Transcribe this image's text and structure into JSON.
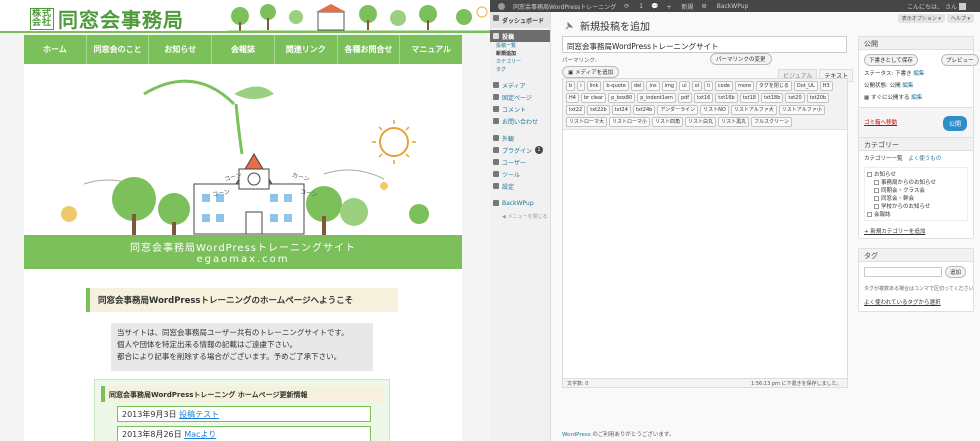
{
  "site": {
    "logo_badge": "株式会社",
    "logo_text": "同窓会事務局",
    "nav": [
      "ホーム",
      "同窓会のこと",
      "お知らせ",
      "会報誌",
      "関連リンク",
      "各種お問合せ",
      "マニュアル"
    ],
    "hero_title": "同窓会事務局WordPressトレーニングサイト",
    "hero_domain": "egaomax.com",
    "hero_words": [
      "コーン",
      "カーン",
      "コーン",
      "コーン"
    ],
    "welcome": "同窓会事務局WordPressトレーニングのホームページへようこそ",
    "notice": [
      "当サイトは、同窓会事務局ユーザー共有のトレーニングサイトです。",
      "個人や団体を特定出来る情報の記載はご遠慮下さい。",
      "都合により記事を削除する場合がございます。予めご了承下さい。"
    ],
    "news_title": "同窓会事務局WordPressトレーニング ホームページ更新情報",
    "news": [
      {
        "date": "2013年9月3日",
        "link": "投稿テスト"
      },
      {
        "date": "2013年8月26日",
        "link": "Macより"
      }
    ]
  },
  "admin": {
    "bar": {
      "site": "同窓会事務局WordPressトレーニング",
      "updates": "1",
      "new": "新規",
      "plugin": "BackWPup",
      "greeting": "こんにちは、",
      "user": "さん"
    },
    "menu": {
      "dashboard": "ダッシュボード",
      "posts": "投稿",
      "posts_sub": [
        "投稿一覧",
        "新規追加",
        "カテゴリー",
        "タグ"
      ],
      "media": "メディア",
      "pages": "固定ページ",
      "comments": "コメント",
      "inquiries": "お問い合わせ",
      "appearance": "外観",
      "plugins": "プラグイン",
      "plugins_badge": "1",
      "users": "ユーザー",
      "tools": "ツール",
      "settings": "設定",
      "backwpup": "BackWPup",
      "collapse": "メニューを閉じる"
    },
    "screen_options": "表示オプション ▾",
    "help": "ヘルプ ▾",
    "page_title": "新規投稿を追加",
    "post_title": "同窓会事務局WordPressトレーニングサイト",
    "permalink_label": "パーマリンク:",
    "permalink_button": "パーマリンクの変更",
    "media_button": "メディアを追加",
    "tabs": [
      "ビジュアル",
      "テキスト"
    ],
    "quicktags": [
      "b",
      "i",
      "link",
      "b-quote",
      "del",
      "ins",
      "img",
      "ul",
      "ol",
      "li",
      "code",
      "more",
      "タグを閉じる",
      "Dot_UL",
      "H3",
      "H4",
      "br clear",
      "p_box80",
      "p_indent1em",
      "pdf",
      "txt16",
      "txt16b",
      "txt18",
      "txt18b",
      "txt20",
      "txt20b",
      "txt22",
      "txt22b",
      "txt24",
      "txt24b",
      "アンダーライン",
      "リストNO",
      "リストアルファ大",
      "リストアルファ小",
      "リストローマ大",
      "リストローマ小",
      "リスト四角",
      "リスト白丸",
      "リスト黒丸",
      "フルスクリーン"
    ],
    "word_count": "文字数: 0",
    "saved": "1:56:13 pm に下書きを保存しました。",
    "footer_link": "WordPress",
    "footer_text": " のご利用ありがとうございます。",
    "publish": {
      "title": "公開",
      "save_draft": "下書きとして保存",
      "preview": "プレビュー",
      "status": "ステータス: 下書き",
      "edit": "編集",
      "visibility": "公開状態: 公開",
      "schedule": "すぐに公開する",
      "trash": "ゴミ箱へ移動",
      "publish": "公開"
    },
    "categories": {
      "title": "カテゴリー",
      "tab_all": "カテゴリー一覧",
      "tab_popular": "よく使うもの",
      "items": [
        "お知らせ",
        "事務局からのお知らせ",
        "同期会・クラス会",
        "同窓会・幹会",
        "学校からのお知らせ",
        "会報誌"
      ],
      "add": "+ 新規カテゴリーを追加"
    },
    "tags": {
      "title": "タグ",
      "add": "追加",
      "hint": "タグが複数ある場合はコンマで区切ってください",
      "popular": "よく使われているタグから選択"
    }
  },
  "colors": {
    "site_green": "#7cc05b",
    "admin_dark": "#464646",
    "link": "#21759b",
    "publish": "#2e8ec7"
  }
}
